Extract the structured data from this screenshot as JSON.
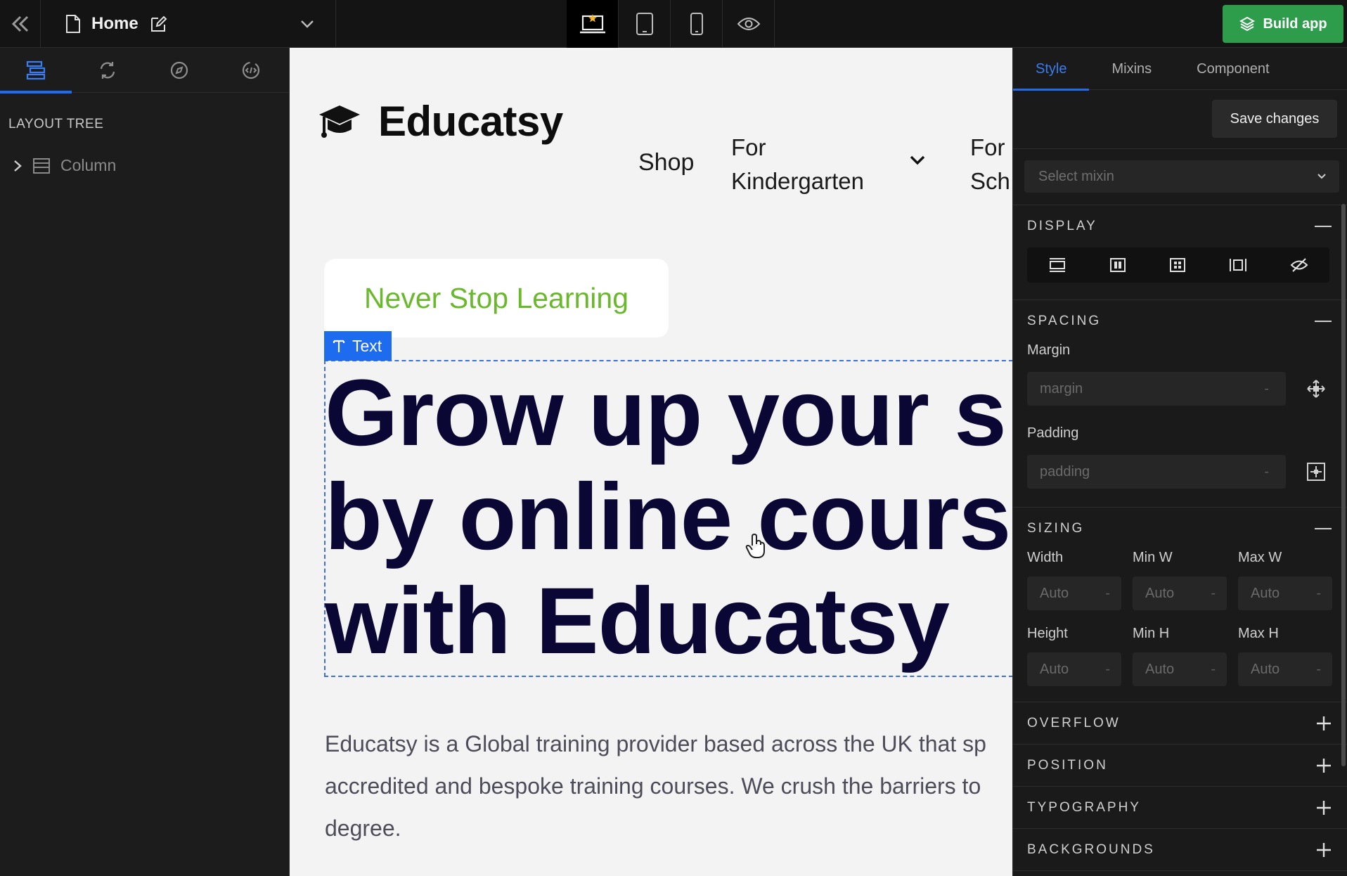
{
  "topbar": {
    "page_name": "Home",
    "build_label": "Build app"
  },
  "left_panel": {
    "heading": "LAYOUT TREE",
    "tree": [
      {
        "label": "Column",
        "icon": "table-icon"
      }
    ]
  },
  "canvas": {
    "brand": "Educatsy",
    "nav": {
      "shop": "Shop",
      "kindergarten_line1": "For",
      "kindergarten_line2": "Kindergarten",
      "school_line1": "For",
      "school_line2": "Sch"
    },
    "tagline": "Never Stop Learning",
    "selection_tag": "Text",
    "hero_line1": "Grow up your sk",
    "hero_line2": "by online course",
    "hero_line3": "with Educatsy",
    "desc_line1": "Educatsy is a Global training provider based across the UK that sp",
    "desc_line2": "accredited and bespoke training courses. We crush the barriers to",
    "desc_line3": "degree."
  },
  "right_panel": {
    "tabs": [
      "Style",
      "Mixins",
      "Component"
    ],
    "save_label": "Save changes",
    "mixin_placeholder": "Select mixin",
    "sections": {
      "display": "DISPLAY",
      "spacing": "SPACING",
      "sizing": "SIZING",
      "overflow": "OVERFLOW",
      "position": "POSITION",
      "typography": "TYPOGRAPHY",
      "backgrounds": "BACKGROUNDS"
    },
    "spacing": {
      "margin_label": "Margin",
      "margin_placeholder": "margin",
      "padding_label": "Padding",
      "padding_placeholder": "padding",
      "dash": "-"
    },
    "sizing": {
      "width_label": "Width",
      "min_w_label": "Min W",
      "max_w_label": "Max W",
      "height_label": "Height",
      "min_h_label": "Min H",
      "max_h_label": "Max H",
      "auto": "Auto",
      "dash": "-"
    }
  },
  "colors": {
    "accent": "#1d6cf0",
    "build_green": "#2d9d4b",
    "tagline_green": "#6ab82c",
    "hero_navy": "#0a0735"
  }
}
